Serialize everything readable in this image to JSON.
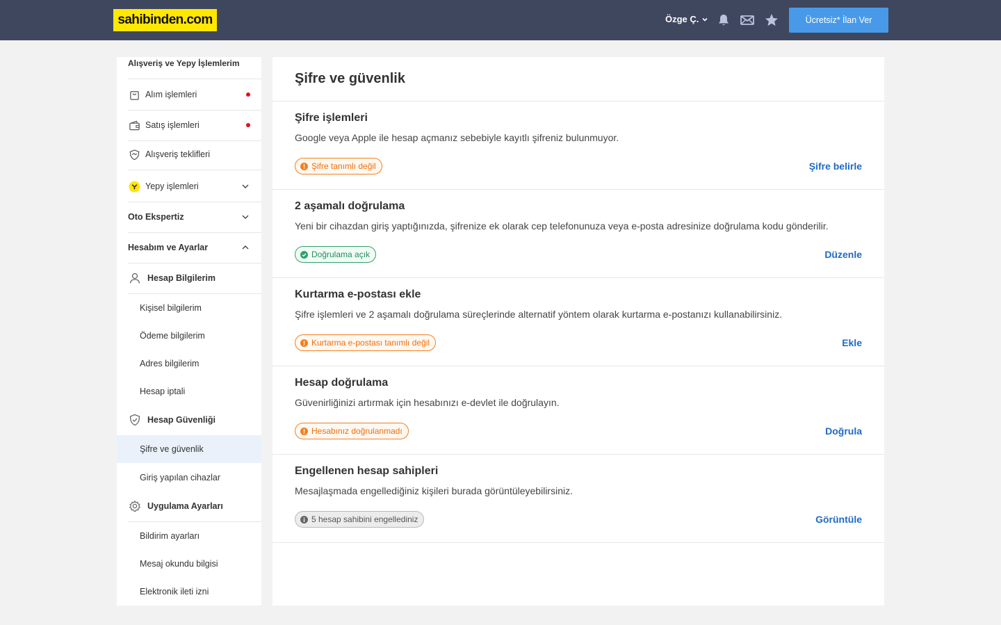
{
  "header": {
    "logo_text": "sahibinden.com",
    "user_name": "Özge Ç.",
    "post_ad_label": "Ücretsiz* İlan Ver",
    "bg_color": "#3f475f",
    "logo_bg_color": "#ffe800",
    "button_color": "#489ae9"
  },
  "sidebar": {
    "section_shopping": "Alışveriş ve Yepy İşlemlerim",
    "shopping_items": [
      {
        "label": "Alım işlemleri",
        "icon": "shopping-bag-icon",
        "has_dot": true
      },
      {
        "label": "Satış işlemleri",
        "icon": "wallet-icon",
        "has_dot": true
      },
      {
        "label": "Alışveriş teklifleri",
        "icon": "handshake-shield-icon",
        "has_dot": false
      },
      {
        "label": "Yepy işlemleri",
        "icon": "yepy-logo-icon",
        "has_chevron": true
      }
    ],
    "oto_label": "Oto Ekspertiz",
    "account_label": "Hesabım ve Ayarlar",
    "account_info": {
      "label": "Hesap Bilgilerim",
      "icon": "user-icon",
      "links": [
        "Kişisel bilgilerim",
        "Ödeme bilgilerim",
        "Adres bilgilerim",
        "Hesap iptali"
      ]
    },
    "account_security": {
      "label": "Hesap Güvenliği",
      "icon": "shield-check-icon",
      "links": [
        "Şifre ve güvenlik",
        "Giriş yapılan cihazlar"
      ]
    },
    "app_settings": {
      "label": "Uygulama Ayarları",
      "icon": "gear-icon",
      "links": [
        "Bildirim ayarları",
        "Mesaj okundu bilgisi",
        "Elektronik ileti izni"
      ]
    },
    "active_link": "Şifre ve güvenlik"
  },
  "main": {
    "title": "Şifre ve güvenlik",
    "cards": [
      {
        "title": "Şifre işlemleri",
        "description": "Google veya Apple ile hesap açmanız sebebiyle kayıtlı şifreniz bulunmuyor.",
        "badge": "Şifre tanımlı değil",
        "badge_status": "warning",
        "action": "Şifre belirle"
      },
      {
        "title": "2 aşamalı doğrulama",
        "description": "Yeni bir cihazdan giriş yaptığınızda, şifrenize ek olarak cep telefonunuza veya e-posta adresinize doğrulama kodu gönderilir.",
        "badge": "Doğrulama açık",
        "badge_status": "success",
        "action": "Düzenle"
      },
      {
        "title": "Kurtarma e-postası ekle",
        "description": "Şifre işlemleri ve 2 aşamalı doğrulama süreçlerinde alternatif yöntem olarak kurtarma e-postanızı kullanabilirsiniz.",
        "badge": "Kurtarma e-postası tanımlı değil",
        "badge_status": "warning",
        "action": "Ekle"
      },
      {
        "title": "Hesap doğrulama",
        "description": "Güvenirliğinizi artırmak için hesabınızı e-devlet ile doğrulayın.",
        "badge": "Hesabınız doğrulanmadı",
        "badge_status": "warning",
        "action": "Doğrula"
      },
      {
        "title": "Engellenen hesap sahipleri",
        "description": "Mesajlaşmada engellediğiniz kişileri burada görüntüleyebilirsiniz.",
        "badge": "5 hesap sahibini engellediniz",
        "badge_status": "info",
        "action": "Görüntüle"
      }
    ]
  },
  "colors": {
    "warning": "#f47f20",
    "success": "#2ba36b",
    "link": "#1e6ac4",
    "active_bg": "#eaf1fb",
    "notification_dot": "#e3101e"
  }
}
